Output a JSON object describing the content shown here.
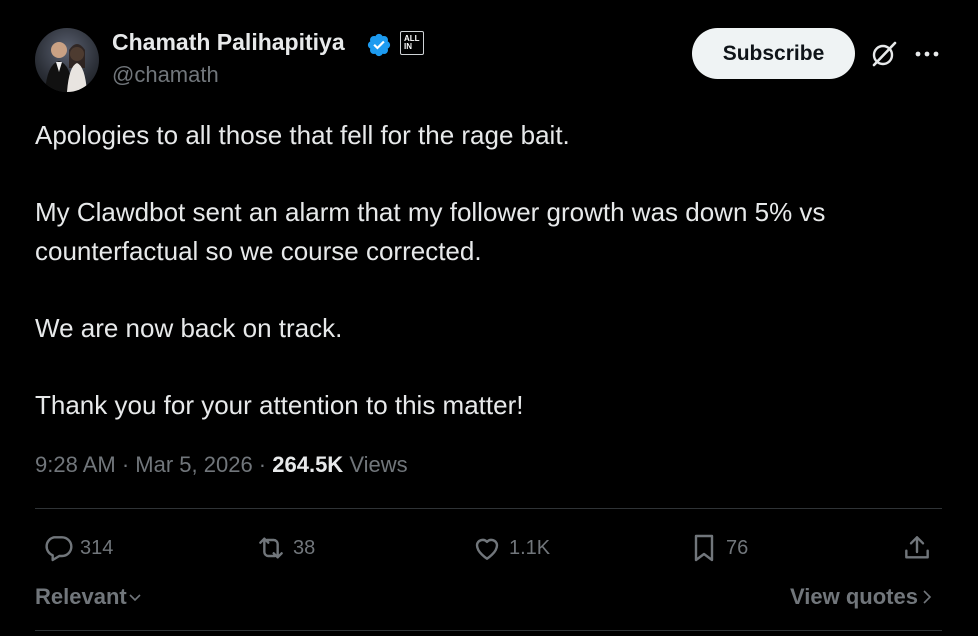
{
  "author": {
    "display_name": "Chamath Palihapitiya",
    "handle": "@chamath",
    "affiliate_badge": "ALL IN"
  },
  "subscribe_label": "Subscribe",
  "post": {
    "paragraphs": [
      "Apologies to all those that fell for the rage bait.",
      "My Clawdbot sent an alarm that my follower growth was down 5% vs counterfactual so we course corrected.",
      "We are now back on track.",
      "Thank you for your attention to this matter!"
    ],
    "time": "9:28 AM",
    "date": "Mar 5, 2026",
    "views_count": "264.5K",
    "views_label": "Views"
  },
  "actions": {
    "replies": "314",
    "reposts": "38",
    "likes": "1.1K",
    "bookmarks": "76"
  },
  "footer": {
    "sort_label": "Relevant",
    "view_quotes_label": "View quotes"
  },
  "colors": {
    "background": "#000000",
    "primary_text": "#e7e9ea",
    "secondary_text": "#71767b",
    "verified_blue": "#1d9bf0",
    "button_bg": "#eff3f4"
  }
}
